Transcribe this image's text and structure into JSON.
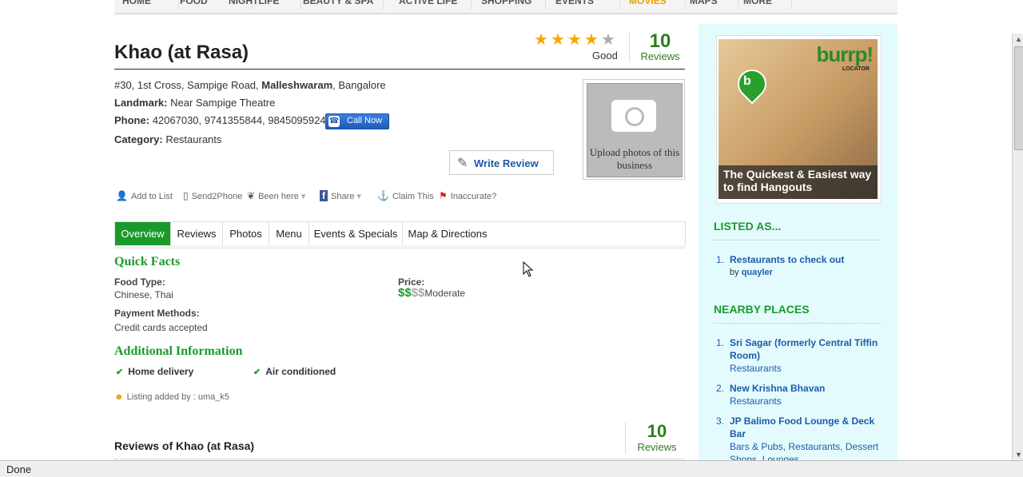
{
  "nav": {
    "items": [
      "HOME",
      "FOOD",
      "NIGHTLIFE",
      "BEAUTY & SPA",
      "ACTIVE LIFE",
      "SHOPPING",
      "EVENTS",
      "MOVIES",
      "MAPS",
      "MORE"
    ]
  },
  "business": {
    "name": "Khao (at Rasa)",
    "rating_word": "Good",
    "review_count": "10",
    "review_label": "Reviews",
    "address_pre": "#30, 1st Cross, Sampige Road, ",
    "address_area": "Malleshwaram",
    "address_post": ", Bangalore",
    "landmark_label": "Landmark:",
    "landmark": "Near Sampige Theatre",
    "phone_label": "Phone:",
    "phone": "42067030, 9741355844, 9845095924",
    "call_label": "Call Now",
    "category_label": "Category:",
    "category": "Restaurants",
    "upload_text": "Upload photos of this business",
    "write_review": "Write Review"
  },
  "rating": {
    "value": 4,
    "max": 5
  },
  "actions": [
    "Add to List",
    "Send2Phone",
    "Been here",
    "Share",
    "Claim This",
    "Inaccurate?"
  ],
  "tabs": [
    "Overview",
    "Reviews",
    "Photos",
    "Menu",
    "Events & Specials",
    "Map & Directions"
  ],
  "quick_facts": {
    "heading": "Quick Facts",
    "food_type_label": "Food Type:",
    "food_type": "Chinese, Thai",
    "price_label": "Price:",
    "price_symbols_on": "$$",
    "price_symbols_off": "$$",
    "price_word": "Moderate",
    "payment_label": "Payment Methods:",
    "payment": "Credit cards accepted"
  },
  "additional": {
    "heading": "Additional Information",
    "items": [
      "Home delivery",
      "Air conditioned"
    ]
  },
  "listing_added": "Listing added by : uma_k5",
  "reviews_section": {
    "title": "Reviews of Khao (at Rasa)",
    "count": "10",
    "label": "Reviews"
  },
  "sidebar": {
    "ad": {
      "brand": "burrp!",
      "sub": "LOCATOR",
      "tagline": "The Quickest & Easiest way to find Hangouts"
    },
    "listed_heading": "LISTED AS...",
    "listed": [
      {
        "num": "1.",
        "title": "Restaurants to check out",
        "by_prefix": "by",
        "by": "quayler"
      }
    ],
    "nearby_heading": "NEARBY PLACES",
    "nearby": [
      {
        "num": "1.",
        "title": "Sri Sagar (formerly Central Tiffin Room)",
        "sub": "Restaurants"
      },
      {
        "num": "2.",
        "title": "New Krishna Bhavan",
        "sub": "Restaurants"
      },
      {
        "num": "3.",
        "title": "JP Balimo Food Lounge & Deck Bar",
        "sub": "Bars & Pubs, Restaurants, Dessert Shops, Lounges"
      }
    ]
  },
  "status_bar": "Done"
}
